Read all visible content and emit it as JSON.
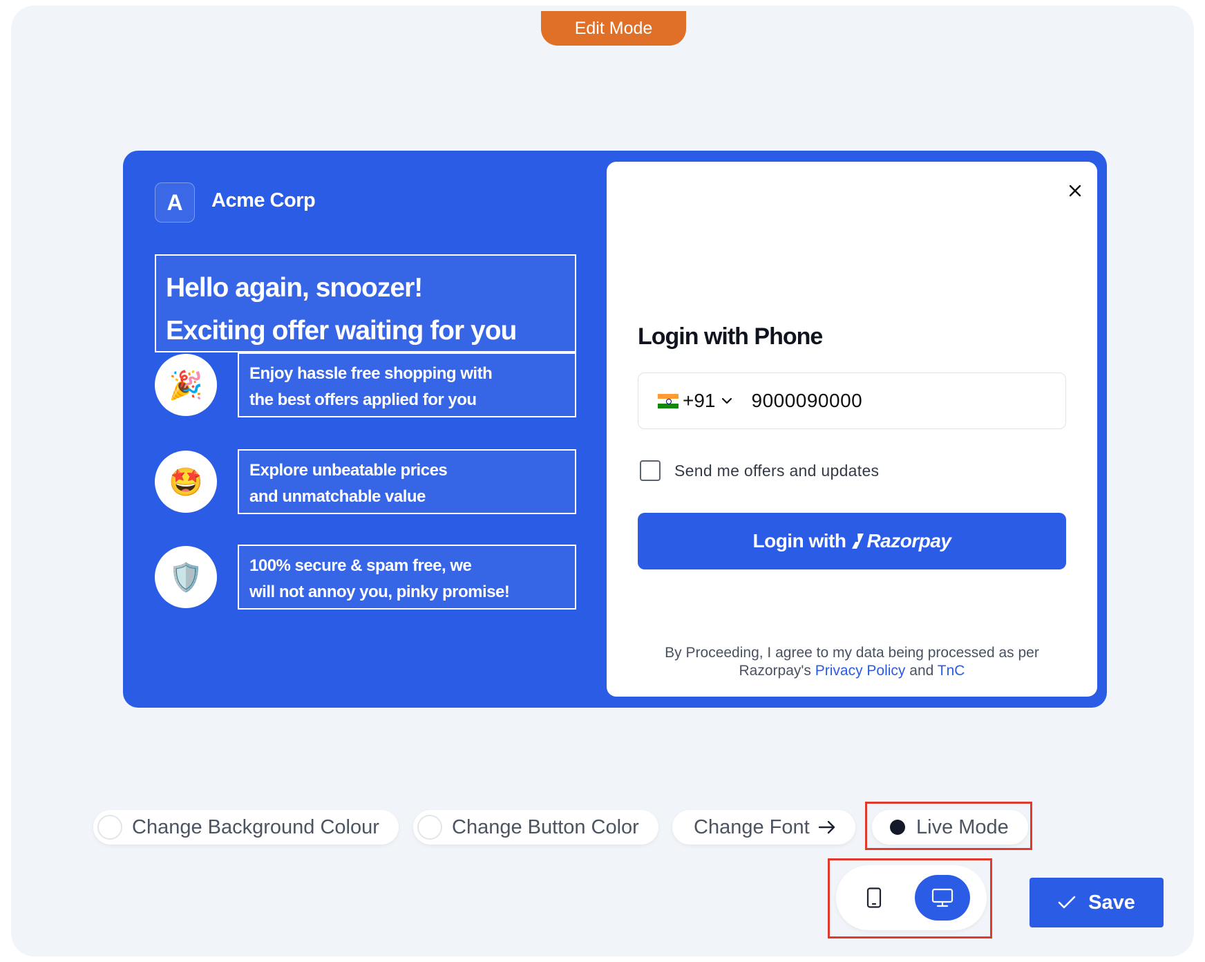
{
  "header": {
    "mode_label": "Edit Mode"
  },
  "brand": {
    "initial": "A",
    "name": "Acme Corp"
  },
  "headline": {
    "line1": "Hello again, snoozer!",
    "line2": "Exciting offer waiting for you"
  },
  "features": [
    {
      "icon": "party-popper-icon",
      "emoji": "🎉",
      "line1": "Enjoy hassle free shopping with",
      "line2": "the best offers applied for you"
    },
    {
      "icon": "star-struck-icon",
      "emoji": "🤩",
      "line1": "Explore unbeatable prices",
      "line2": "and unmatchable value"
    },
    {
      "icon": "shield-icon",
      "emoji": "🛡️",
      "line1": "100% secure & spam free, we",
      "line2": "will not annoy you, pinky promise!"
    }
  ],
  "login": {
    "title": "Login with Phone",
    "country_code": "+91",
    "phone_value": "9000090000",
    "offers_checkbox_label": "Send me offers and updates",
    "offers_checked": false,
    "button_prefix": "Login with",
    "button_brand": "Razorpay",
    "consent_text_1": "By Proceeding, I agree to my data being processed as per",
    "consent_text_2": "Razorpay's",
    "privacy_link": "Privacy Policy",
    "and_text": "and",
    "tnc_link": "TnC"
  },
  "controls": {
    "bg_colour_label": "Change Background Colour",
    "button_color_label": "Change Button Color",
    "font_label": "Change Font",
    "live_mode_label": "Live Mode",
    "device_selected": "desktop",
    "save_label": "Save"
  },
  "colors": {
    "primary": "#2a5ce5",
    "edit_mode": "#e07028",
    "highlight": "#e03a2f",
    "canvas_bg": "#f1f4f8"
  }
}
